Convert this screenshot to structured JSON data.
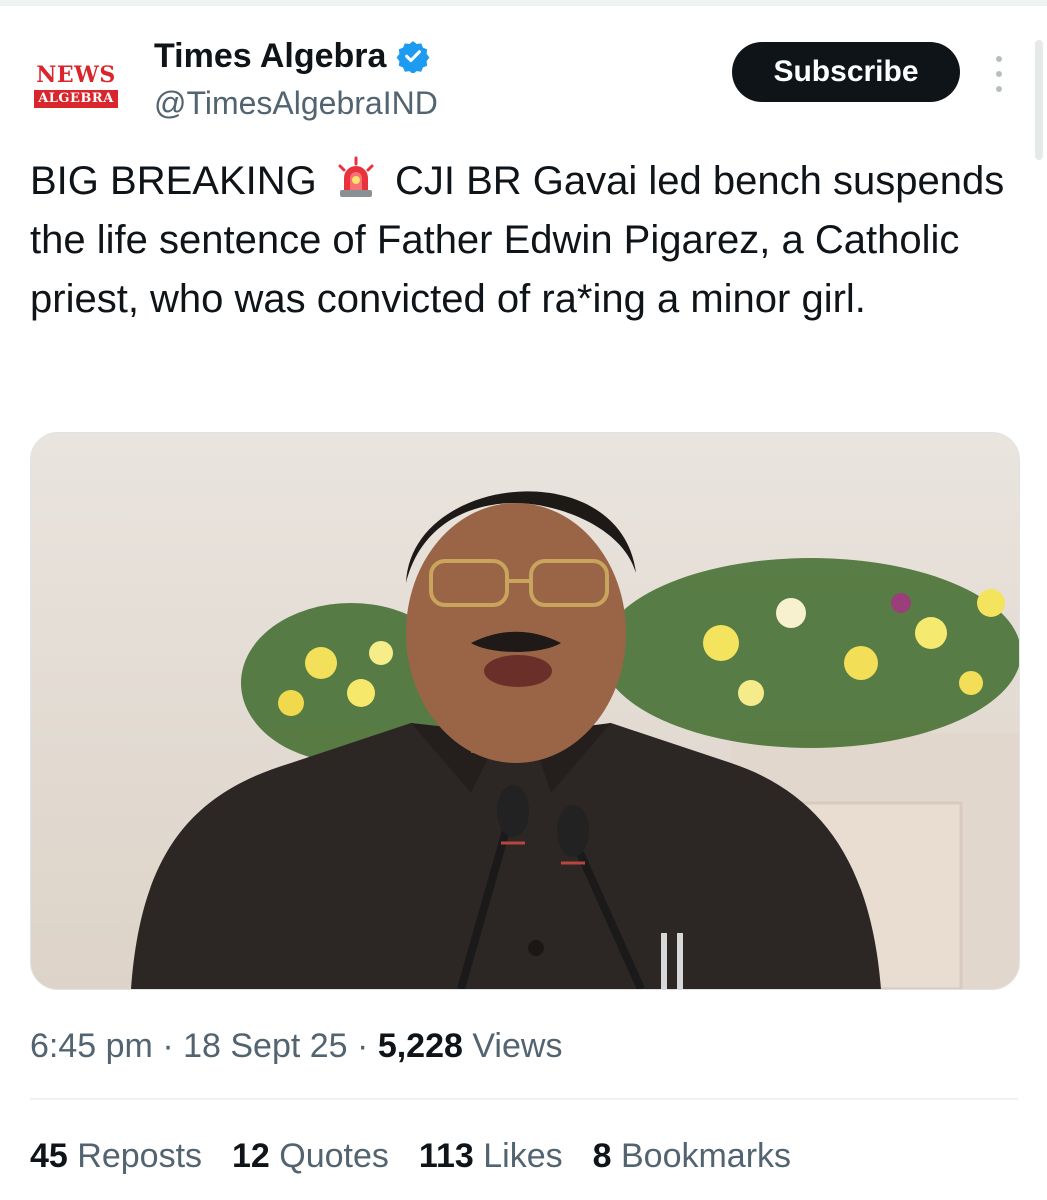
{
  "author": {
    "display_name": "Times Algebra",
    "handle": "@TimesAlgebraIND",
    "logo_text_top": "NEWS",
    "logo_text_bottom": "ALGEBRA",
    "verified_icon": "verified-badge-icon"
  },
  "actions": {
    "subscribe_label": "Subscribe",
    "more_icon": "vertical-ellipsis-icon"
  },
  "tweet": {
    "text_before": "BIG BREAKING",
    "emoji": "🚨",
    "text_after": "CJI BR Gavai led bench suspends the life sentence of Father Edwin Pigarez, a Catholic priest, who was convicted of ra*ing a minor girl.",
    "time": "6:45 pm",
    "separator": "·",
    "date": "18 Sept 25",
    "views_count": "5,228",
    "views_label": "Views"
  },
  "engagement": {
    "reposts_count": "45",
    "reposts_label": "Reposts",
    "quotes_count": "12",
    "quotes_label": "Quotes",
    "likes_count": "113",
    "likes_label": "Likes",
    "bookmarks_count": "8",
    "bookmarks_label": "Bookmarks"
  },
  "colors": {
    "accent": "#1d9bf0",
    "text": "#0f1419",
    "secondary_text": "#536471",
    "logo_red": "#d9262c",
    "button_bg": "#0f1419"
  }
}
